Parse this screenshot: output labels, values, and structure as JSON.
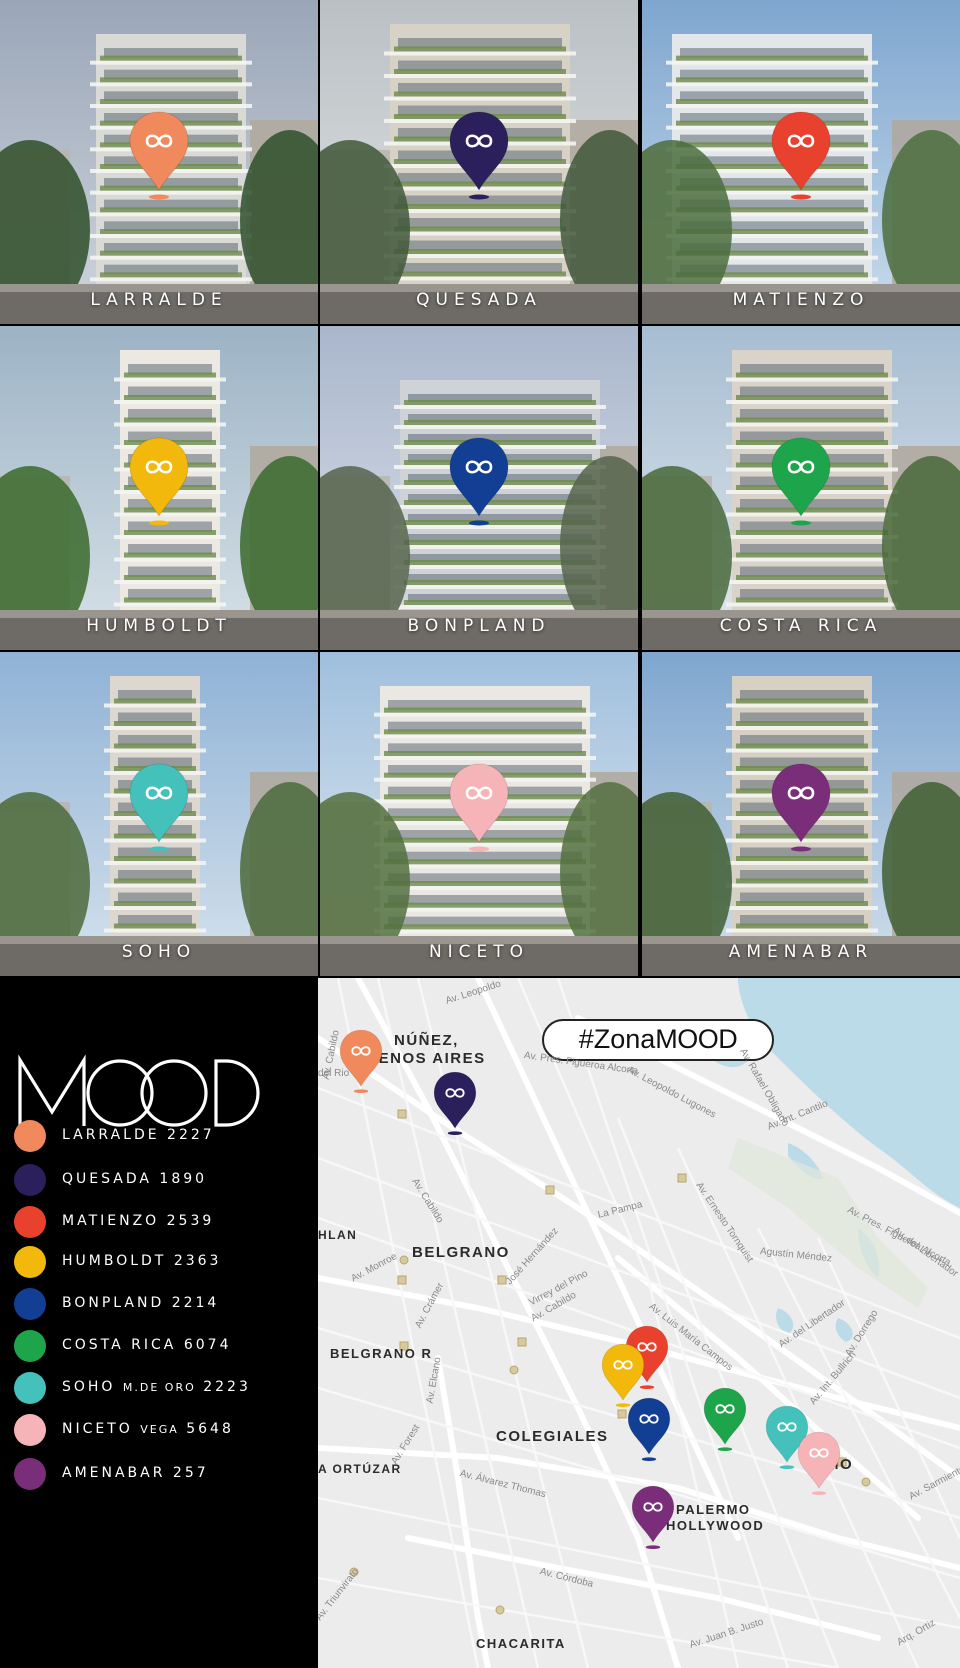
{
  "buildings": [
    {
      "name": "LARRALDE",
      "color": "#f08a5d"
    },
    {
      "name": "QUESADA",
      "color": "#2b1f5c"
    },
    {
      "name": "MATIENZO",
      "color": "#e8412d"
    },
    {
      "name": "HUMBOLDT",
      "color": "#f2b90c"
    },
    {
      "name": "BONPLAND",
      "color": "#123e93"
    },
    {
      "name": "COSTA RICA",
      "color": "#1ea44a"
    },
    {
      "name": "SOHO",
      "color": "#45c1bb"
    },
    {
      "name": "NICETO",
      "color": "#f6b4b8"
    },
    {
      "name": "AMENABAR",
      "color": "#7a2d78"
    }
  ],
  "brand": {
    "logo_text": "MOOD"
  },
  "legend": [
    {
      "name": "LARRALDE",
      "extra": "",
      "number": "2227",
      "color": "#f08a5d"
    },
    {
      "name": "QUESADA",
      "extra": "",
      "number": "1890",
      "color": "#2b1f5c"
    },
    {
      "name": "MATIENZO",
      "extra": "",
      "number": "2539",
      "color": "#e8412d"
    },
    {
      "name": "HUMBOLDT",
      "extra": "",
      "number": "2363",
      "color": "#f2b90c"
    },
    {
      "name": "BONPLAND",
      "extra": "",
      "number": "2214",
      "color": "#123e93"
    },
    {
      "name": "COSTA RICA",
      "extra": "",
      "number": "6074",
      "color": "#1ea44a"
    },
    {
      "name": "SOHO",
      "extra": "M.DE ORO",
      "number": "2223",
      "color": "#45c1bb"
    },
    {
      "name": "NICETO",
      "extra": "VEGA",
      "number": "5648",
      "color": "#f6b4b8"
    },
    {
      "name": "AMENABAR",
      "extra": "",
      "number": "257",
      "color": "#7a2d78"
    }
  ],
  "map": {
    "hashtag_prefix": "#Zona",
    "hashtag_suffix": "MOOD",
    "areas": {
      "nunez_1": "NÚÑEZ,",
      "nunez_2": "BUENOS AIRES",
      "belgrano": "BELGRANO",
      "belgrano_r": "BELGRANO R",
      "colegiales": "COLEGIALES",
      "palermo_1": "PALERMO",
      "palermo_2": "HOLLYWOOD",
      "chacarita": "CHACARITA",
      "ortuzar": "A ORTÚZAR",
      "hlan": "HLAN",
      "mo": "MO"
    },
    "streets": {
      "leopoldo": "Av. Leopoldo",
      "lugones": "Av. Leopoldo Lugones",
      "figueroa": "Av. Pres. Figueroa Alcorta",
      "cantilo": "Av. Int. Cantilo",
      "cabildo": "Av. Cabildo",
      "cabildo2": "Av. Cabildo",
      "monroe": "Av. Monroe",
      "lapampa": "La Pampa",
      "hernandez": "José Hernández",
      "virrey": "Virrey del Pino",
      "crámer": "Av. Crámer",
      "amadeo": "Av. Luis María Campos",
      "libertador": "Av. del Libertador",
      "dorrego": "Av. Dorrego",
      "elcano": "Av. Elcano",
      "forest": "Av. Forest",
      "alvarez": "Av. Álvarez Thomas",
      "cordoba": "Av. Córdoba",
      "bullrich": "Av. Int. Bullrich",
      "justo": "Av. Juan B. Justo",
      "triunvirato": "Av. Triunvirato",
      "tamborini": "Av. Ernesto Tornquist",
      "guemes": "Agustín Méndez",
      "cabildo3": "Av. Cabildo",
      "ortiz": "Arq. Ortiz",
      "delrio": "del Rio",
      "obligado": "Av. Rafael Obligado",
      "sarmiento": "Av. Sarmiento",
      "figueroa2": "Av. Pres. Figueroa Alcorta",
      "delaelo": "Av. del Libertador"
    }
  }
}
